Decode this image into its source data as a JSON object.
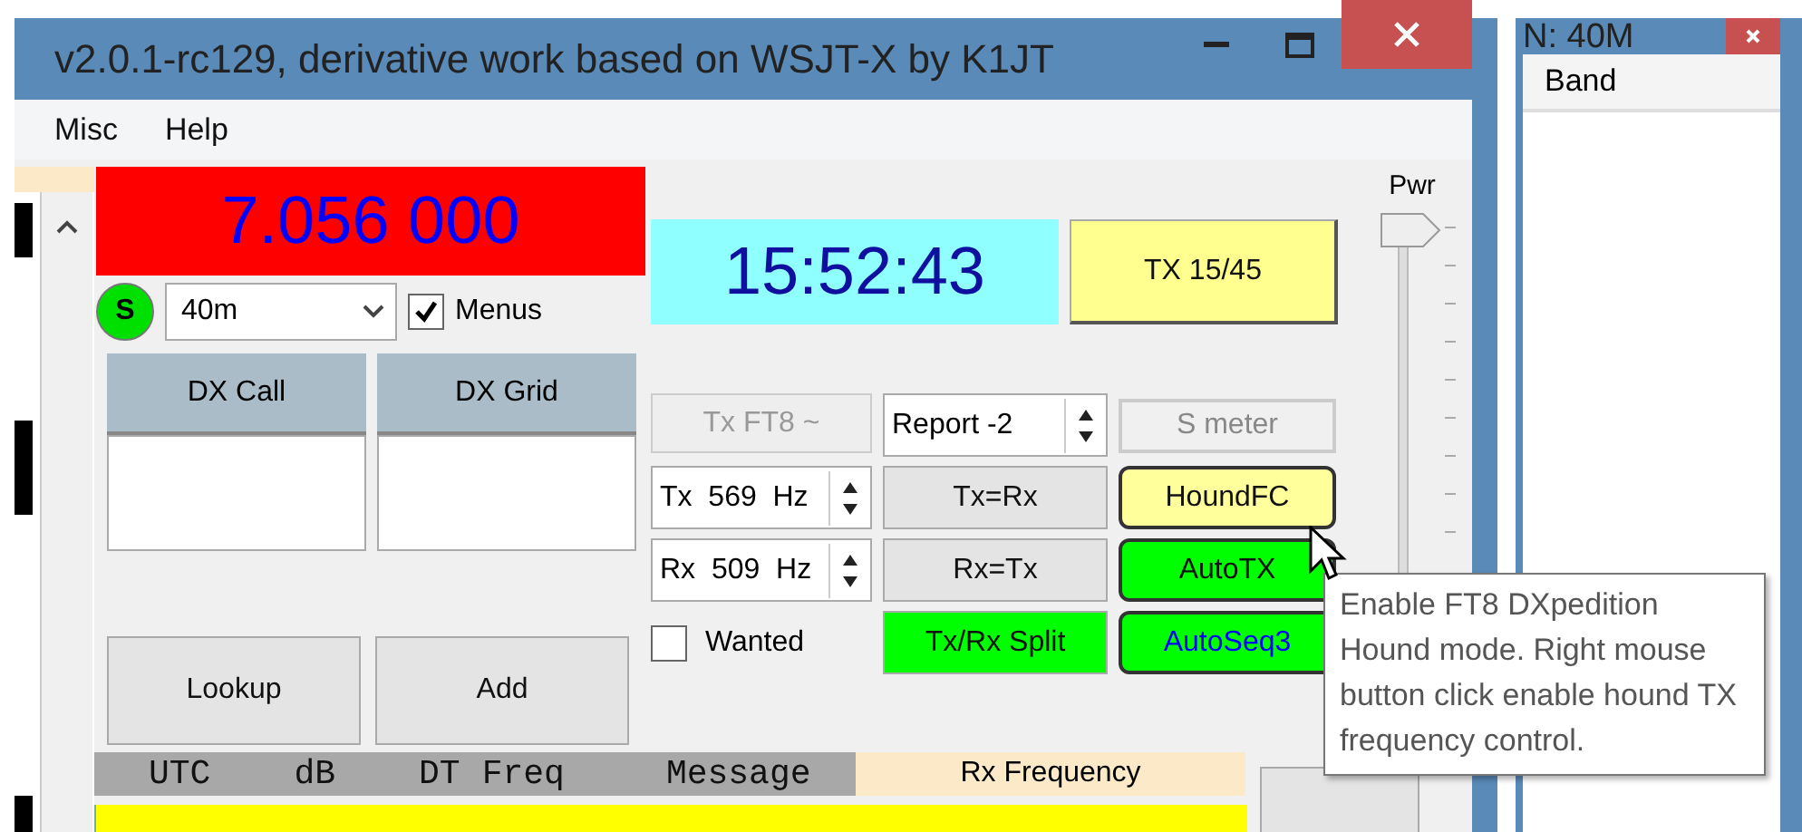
{
  "window": {
    "title": "v2.0.1-rc129, derivative work based on WSJT-X by K1JT"
  },
  "menu": [
    {
      "label": "Misc"
    },
    {
      "label": "Help"
    }
  ],
  "frequency": "7.056 000",
  "status_indicator": "S",
  "band": {
    "value": "40m"
  },
  "menus_checkbox": {
    "label": "Menus",
    "checked": true
  },
  "dx_fields": [
    {
      "label": "DX Call"
    },
    {
      "label": "DX Grid"
    }
  ],
  "actions": [
    {
      "label": "Lookup"
    },
    {
      "label": "Add"
    }
  ],
  "clock": "15:52:43",
  "tx_period_button": "TX 15/45",
  "tx_mode_button": {
    "label": "Tx FT8 ~",
    "disabled": true
  },
  "report": {
    "value": "Report -2"
  },
  "s_meter": {
    "label": "S meter"
  },
  "tx_freq": {
    "value": "Tx  569  Hz"
  },
  "rx_freq": {
    "value": "Rx  509  Hz"
  },
  "tx_eq_rx_button": "Tx=Rx",
  "rx_eq_tx_button": "Rx=Tx",
  "wanted": {
    "label": "Wanted",
    "checked": false
  },
  "split_button": {
    "label": "Tx/Rx Split",
    "on": true
  },
  "toggles": [
    {
      "label": "HoundFC",
      "on": false,
      "hovered": true
    },
    {
      "label": "AutoTX",
      "on": true
    },
    {
      "label": "AutoSeq3",
      "on": true
    }
  ],
  "power": {
    "label": "Pwr",
    "level": 1
  },
  "decode_table": {
    "columns": [
      "UTC",
      "dB",
      "DT",
      "Freq",
      "Message"
    ],
    "rx_frequency_header": "Rx Frequency"
  },
  "tooltip": "Enable FT8 DXpedition Hound mode. Right mouse button click enable hound TX frequency control.",
  "side_window": {
    "title": "N: 40M",
    "columns": [
      "Band"
    ]
  }
}
